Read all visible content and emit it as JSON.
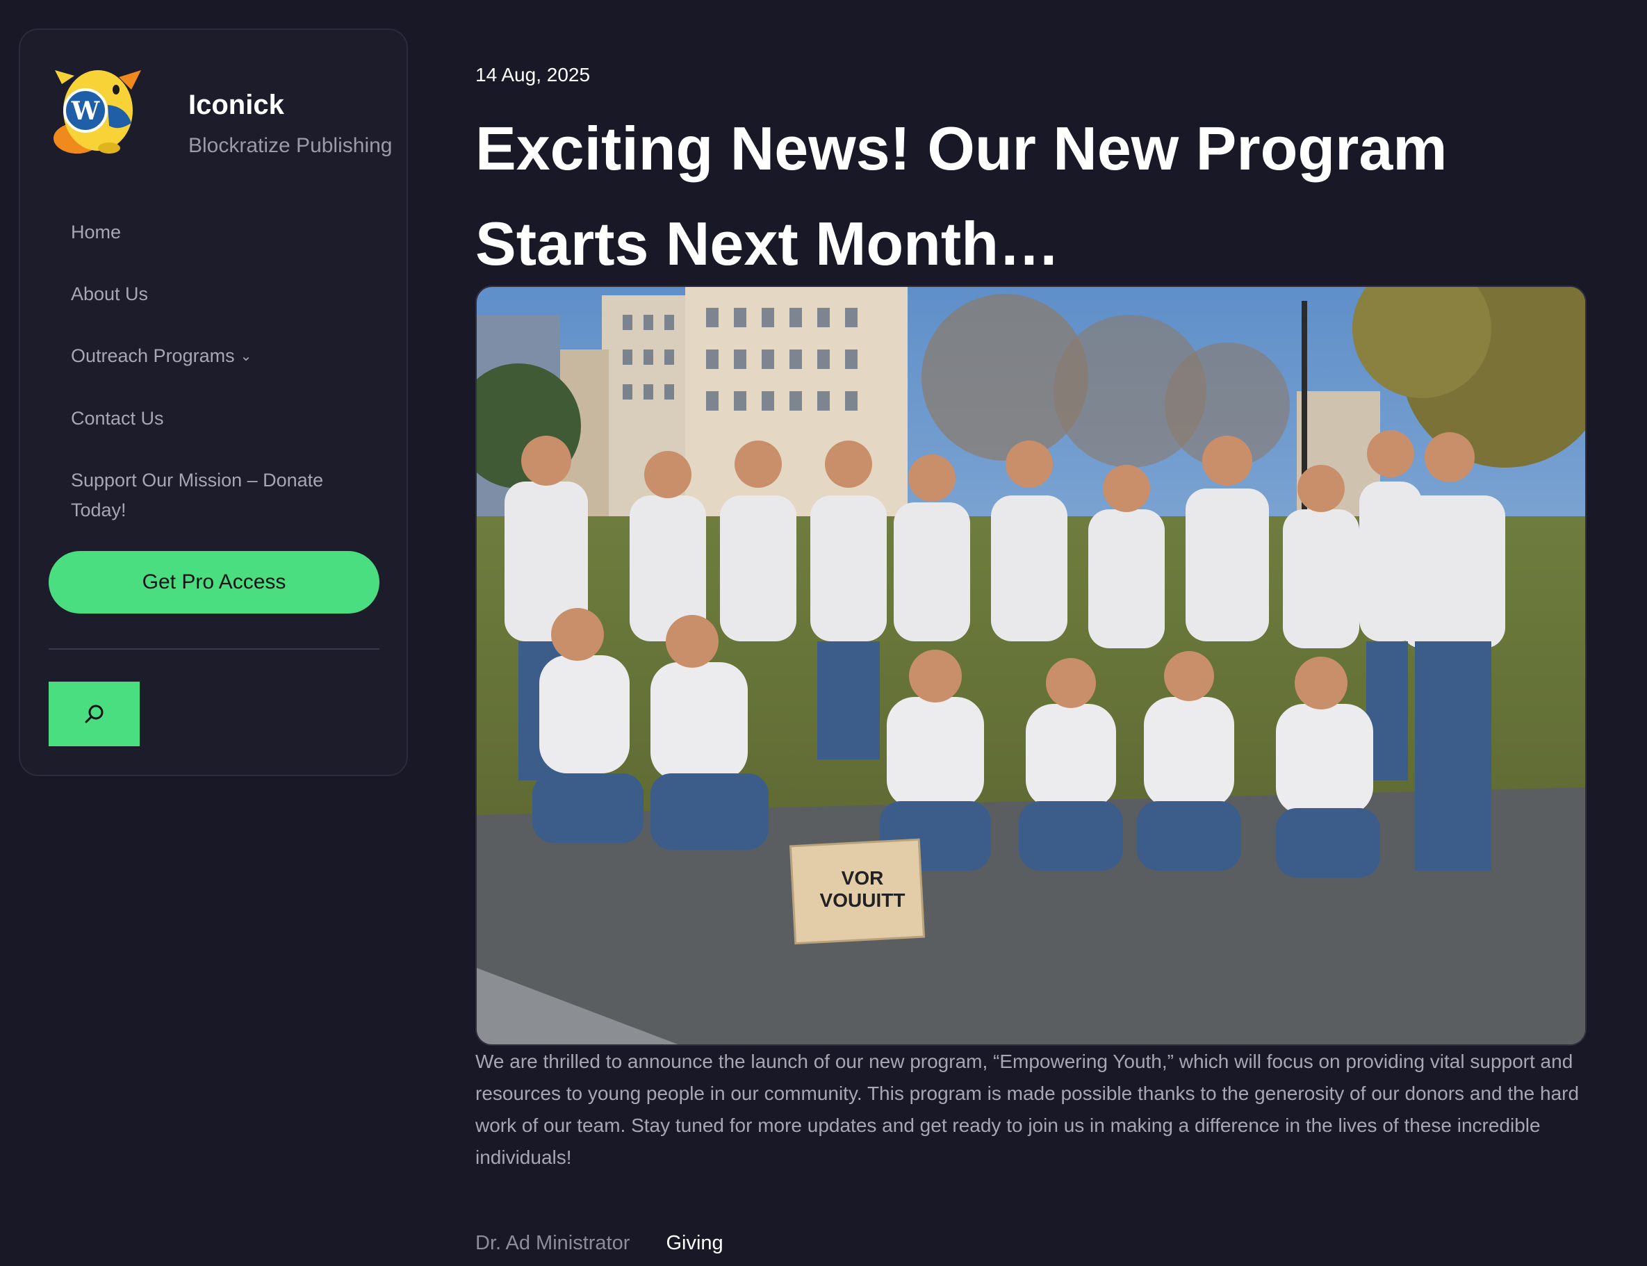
{
  "site": {
    "title": "Iconick",
    "tagline": "Blockratize Publishing",
    "logo_icon": "wapuu-mascot-icon"
  },
  "nav": {
    "items": [
      {
        "label": "Home"
      },
      {
        "label": "About Us"
      },
      {
        "label": "Outreach Programs",
        "icon": "chevron-down-icon",
        "icon_glyph": "⌄"
      },
      {
        "label": "Contact Us"
      },
      {
        "label": "Support Our Mission – Donate Today!"
      }
    ]
  },
  "cta": {
    "label": "Get Pro Access"
  },
  "search": {
    "icon": "search-icon"
  },
  "post": {
    "date": "14 Aug, 2025",
    "title": "Exciting News! Our New Program Starts Next Month…",
    "sign_text_line1": "VOR",
    "sign_text_line2": "VOUUITT",
    "body": "We are thrilled to announce the launch of our new program, “Empowering Youth,” which will focus on providing vital support and resources to young people in our community. This program is made possible thanks to the generosity of our donors and the hard work of our team. Stay tuned for more updates and get ready to join us in making a difference in the lives of these incredible individuals!",
    "author": "Dr. Ad Ministrator",
    "category": "Giving"
  },
  "colors": {
    "background": "#181826",
    "sidebar": "#1c1c2b",
    "accent": "#4ade80",
    "muted_text": "#a7a7b4"
  }
}
